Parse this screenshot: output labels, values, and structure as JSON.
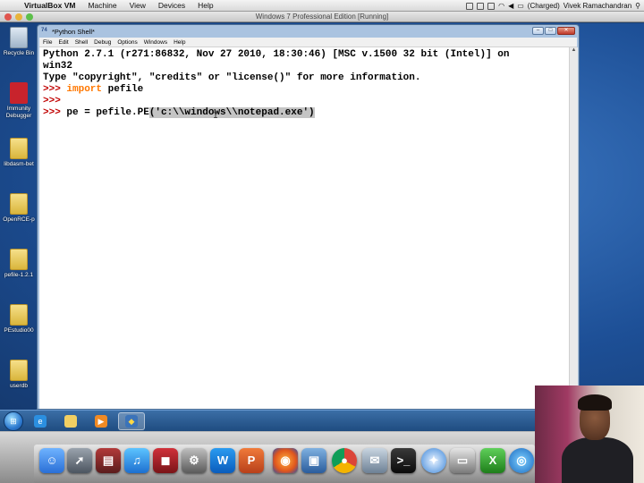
{
  "mac_menubar": {
    "items": [
      "VirtualBox VM",
      "Machine",
      "View",
      "Devices",
      "Help"
    ],
    "status": {
      "battery": "(Charged)",
      "user": "Vivek Ramachandran"
    }
  },
  "vbox_window": {
    "title": "Windows 7 Professional Edition [Running]"
  },
  "desktop_icons": [
    {
      "label": "Recycle Bin",
      "kind": "bin"
    },
    {
      "label": "Immunity Debugger",
      "kind": "immunity"
    },
    {
      "label": "libdasm-bet",
      "kind": "folder"
    },
    {
      "label": "OpenRCE-p",
      "kind": "folder"
    },
    {
      "label": "pefile-1.2.1",
      "kind": "folder"
    },
    {
      "label": "PEstudio00",
      "kind": "folder"
    },
    {
      "label": "userdb",
      "kind": "folder"
    }
  ],
  "shell_window": {
    "title": "*Python Shell*",
    "menu": [
      "File",
      "Edit",
      "Shell",
      "Debug",
      "Options",
      "Windows",
      "Help"
    ],
    "lines": {
      "banner1": "Python 2.7.1 (r271:86832, Nov 27 2010, 18:30:46) [MSC v.1500 32 bit (Intel)] on",
      "banner2": "win32",
      "banner3": "Type \"copyright\", \"credits\" or \"license()\" for more information.",
      "prompt": ">>> ",
      "import_kw": "import",
      "import_rest": " pefile",
      "cmd_pre": "pe = pefile.PE",
      "cmd_hl": "('c:\\\\windows\\\\notepad.exe')"
    }
  },
  "colors": {
    "prompt": "#c00000",
    "keyword": "#ff7700",
    "selection": "#c4c4c4"
  }
}
